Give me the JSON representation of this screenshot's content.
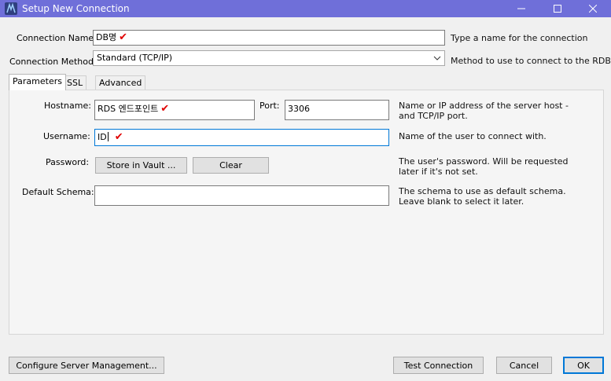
{
  "window": {
    "title": "Setup New Connection",
    "icon": "mysql-workbench-icon"
  },
  "connection_name": {
    "label": "Connection Name:",
    "value": "DB명",
    "hint": "Type a name for the connection"
  },
  "connection_method": {
    "label": "Connection Method:",
    "value": "Standard (TCP/IP)",
    "hint": "Method to use to connect to the RDBMS"
  },
  "tabs": [
    {
      "label": "Parameters",
      "active": true
    },
    {
      "label": "SSL",
      "active": false
    },
    {
      "label": "Advanced",
      "active": false
    }
  ],
  "parameters": {
    "hostname": {
      "label": "Hostname:",
      "value": "RDS 엔드포인트",
      "hint": "Name or IP address of the server host - and TCP/IP port."
    },
    "port": {
      "label": "Port:",
      "value": "3306"
    },
    "username": {
      "label": "Username:",
      "value": "ID",
      "hint": "Name of the user to connect with."
    },
    "password": {
      "label": "Password:",
      "store_button": "Store in Vault ...",
      "clear_button": "Clear",
      "hint": "The user's password. Will be requested later if it's not set."
    },
    "default_schema": {
      "label": "Default Schema:",
      "value": "",
      "hint": "The schema to use as default schema. Leave blank to select it later."
    }
  },
  "annotation_mark": "✔",
  "footer": {
    "configure_button": "Configure Server Management...",
    "test_button": "Test Connection",
    "cancel_button": "Cancel",
    "ok_button": "OK"
  },
  "colors": {
    "titlebar": "#6f6fd9",
    "annotation": "#e00000",
    "focus": "#0078d7"
  }
}
